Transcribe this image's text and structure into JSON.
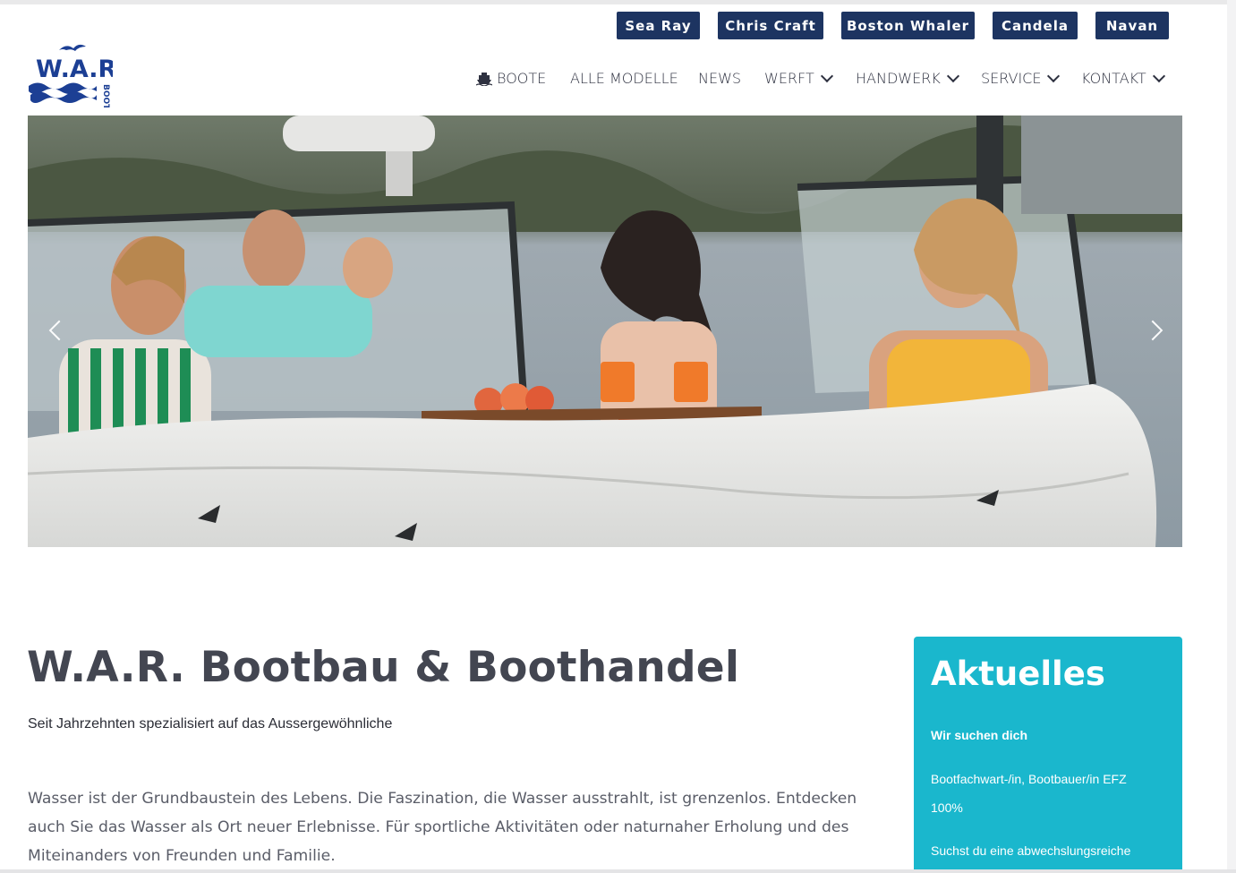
{
  "brands": [
    "Sea Ray",
    "Chris Craft",
    "Boston Whaler",
    "Candela",
    "Navan"
  ],
  "logo": {
    "text": "W.A.R.",
    "sub": "BOOT",
    "color": "#1c3f94"
  },
  "nav": {
    "boote": "BOOTE",
    "alle_modelle": "ALLE MODELLE",
    "news": "NEWS",
    "werft": "WERFT",
    "handwerk": "HANDWERK",
    "service": "SERVICE",
    "kontakt": "KONTAKT"
  },
  "hero": {
    "icons": [
      "chevron-left-icon",
      "chevron-right-icon"
    ]
  },
  "main": {
    "title": "W.A.R. Bootbau & Boothandel",
    "subtitle": "Seit Jahrzehnten spezialisiert auf das Aussergewöhnliche",
    "paragraph": "Wasser ist der Grundbaustein des Lebens. Die Faszination, die Wasser ausstrahlt, ist grenzenlos. Entdecken auch Sie das Wasser als Ort neuer Erlebnisse. Für sportliche Aktivitäten oder naturnaher Erholung und des Miteinanders von Freunden und Familie."
  },
  "sidebar": {
    "title": "Aktuelles",
    "headline": "Wir suchen dich",
    "job": "Bootfachwart-/in, Bootbauer/in EFZ",
    "percent": "100%",
    "teaser": "Suchst du eine abwechslungsreiche"
  },
  "colors": {
    "brand_bar": "#1d3461",
    "sidebar": "#1ab7cd",
    "heading": "#434651"
  }
}
